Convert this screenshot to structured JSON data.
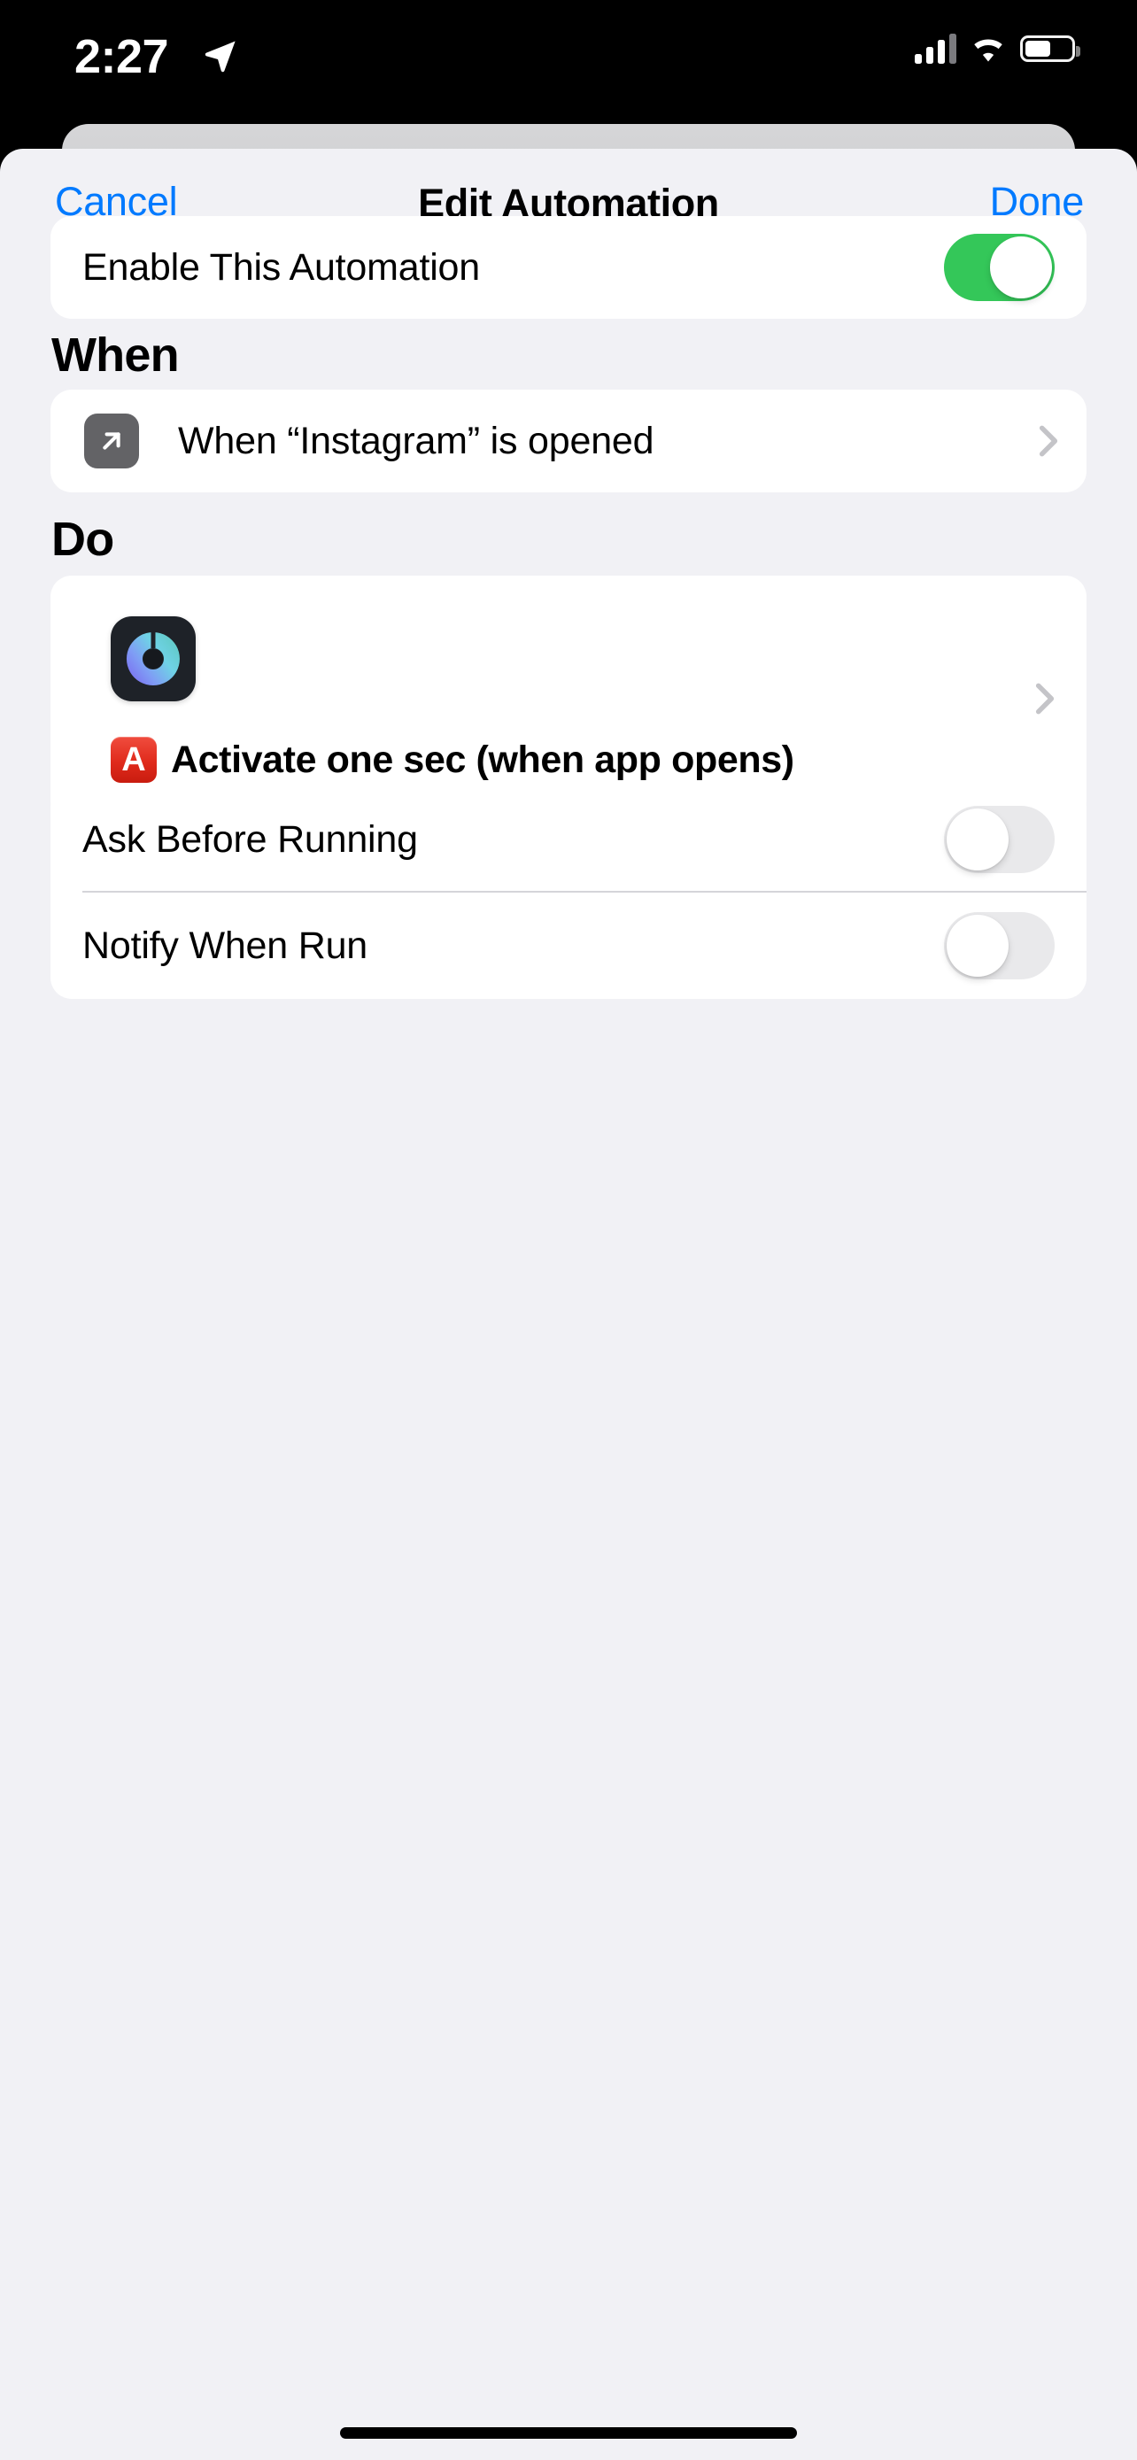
{
  "status_bar": {
    "time": "2:27",
    "location_icon": "location-arrow-icon",
    "cellular_icon": "cellular-signal-icon",
    "wifi_icon": "wifi-icon",
    "battery_icon": "battery-icon",
    "battery_level_percent": 55
  },
  "nav": {
    "cancel_label": "Cancel",
    "title": "Edit Automation",
    "done_label": "Done",
    "tint_color": "#007AFF"
  },
  "enable_section": {
    "label": "Enable This Automation",
    "toggle_state": "on",
    "toggle_on_color": "#34C759"
  },
  "when_section": {
    "header": "When",
    "trigger": {
      "icon": "arrow-up-forward-icon",
      "icon_background": "#636366",
      "text": "When “Instagram” is opened",
      "chevron": "chevron-right-icon"
    }
  },
  "do_section": {
    "header": "Do",
    "action": {
      "app_icon": "one-sec-app-icon",
      "app_icon_background": "#1E2228",
      "badge_icon": "letter-a-red-emoji",
      "text": "Activate one sec (when app opens)",
      "chevron": "chevron-right-icon"
    }
  },
  "options_section": {
    "rows": [
      {
        "label": "Ask Before Running",
        "toggle_state": "off"
      },
      {
        "label": "Notify When Run",
        "toggle_state": "off"
      }
    ],
    "toggle_off_color": "#E9E9EB"
  },
  "home_indicator": "home-indicator"
}
